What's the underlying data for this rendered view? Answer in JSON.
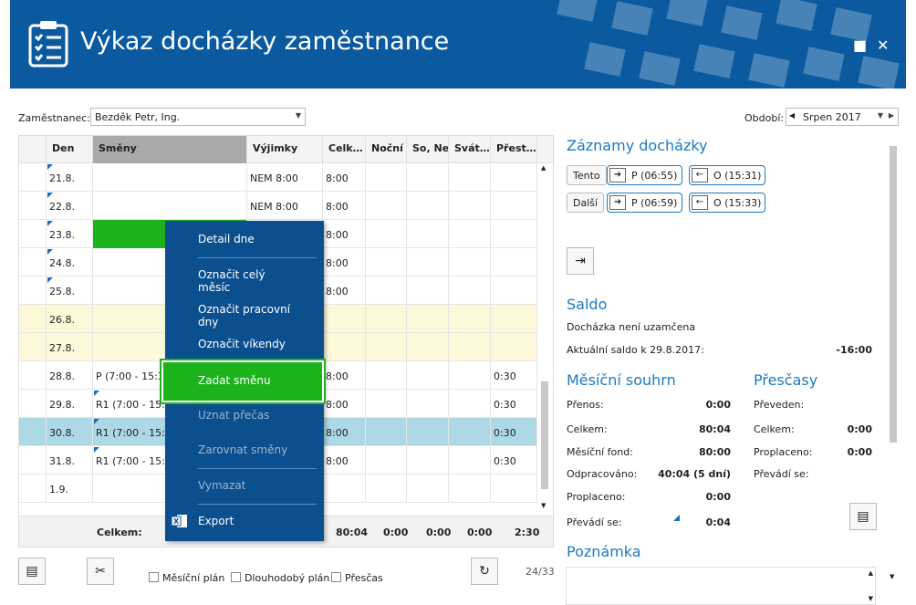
{
  "window": {
    "title": "Výkaz docházky zaměstnance",
    "maximize_icon": "■",
    "close_icon": "✕"
  },
  "filters": {
    "employee_label": "Zaměstnanec:",
    "employee_value": "Bezděk Petr, Ing.",
    "period_label": "Období:",
    "period_value": "Srpen 2017"
  },
  "grid": {
    "columns": [
      "Den",
      "Směny",
      "Výjimky",
      "Celk…",
      "Noční",
      "So, Ne",
      "Svát…",
      "Přest…"
    ],
    "rows": [
      {
        "day": "21.8.",
        "shift": "",
        "exception": "NEM 8:00",
        "total": "8:00",
        "night": "",
        "weekend": "",
        "holiday": "",
        "break": ""
      },
      {
        "day": "22.8.",
        "shift": "",
        "exception": "NEM 8:00",
        "total": "8:00",
        "night": "",
        "weekend": "",
        "holiday": "",
        "break": ""
      },
      {
        "day": "23.8.",
        "shift": "",
        "exception": "",
        "total": "8:00",
        "night": "",
        "weekend": "",
        "holiday": "",
        "break": ""
      },
      {
        "day": "24.8.",
        "shift": "",
        "exception": "",
        "total": "8:00",
        "night": "",
        "weekend": "",
        "holiday": "",
        "break": ""
      },
      {
        "day": "25.8.",
        "shift": "",
        "exception": "",
        "total": "8:00",
        "night": "",
        "weekend": "",
        "holiday": "",
        "break": ""
      },
      {
        "day": "26.8.",
        "shift": "",
        "exception": "",
        "total": "",
        "night": "",
        "weekend": "",
        "holiday": "",
        "break": ""
      },
      {
        "day": "27.8.",
        "shift": "",
        "exception": "",
        "total": "",
        "night": "",
        "weekend": "",
        "holiday": "",
        "break": ""
      },
      {
        "day": "28.8.",
        "shift": "P (7:00 - 15:30",
        "exception": "",
        "total": "8:00",
        "night": "",
        "weekend": "",
        "holiday": "",
        "break": "0:30"
      },
      {
        "day": "29.8.",
        "shift": "R1 (7:00 - 15:30",
        "exception": "",
        "total": "8:00",
        "night": "",
        "weekend": "",
        "holiday": "",
        "break": "0:30"
      },
      {
        "day": "30.8.",
        "shift": "R1 (7:00 - 15:30",
        "exception": "",
        "total": "8:00",
        "night": "",
        "weekend": "",
        "holiday": "",
        "break": "0:30"
      },
      {
        "day": "31.8.",
        "shift": "R1 (7:00 - 15:30",
        "exception": "",
        "total": "8:00",
        "night": "",
        "weekend": "",
        "holiday": "",
        "break": "0:30"
      },
      {
        "day": "1.9.",
        "shift": "",
        "exception": "",
        "total": "",
        "night": "",
        "weekend": "",
        "holiday": "",
        "break": ""
      }
    ],
    "footer": {
      "label": "Celkem:",
      "total": "80:04",
      "night": "0:00",
      "weekend": "0:00",
      "holiday": "0:00",
      "break": "2:30"
    }
  },
  "context_menu": {
    "items": [
      "Detail dne",
      "Označit celý měsíc",
      "Označit pracovní dny",
      "Označit víkendy",
      "Zadat směnu",
      "Uznat přečas",
      "Zarovnat směny",
      "Vymazat",
      "Export"
    ]
  },
  "bottom": {
    "monthly_plan": "Měsíční plán",
    "long_plan": "Dlouhodobý plán",
    "overtime": "Přesčas",
    "counter": "24/33"
  },
  "records": {
    "title": "Záznamy docházky",
    "this_btn": "Tento",
    "next_btn": "Další",
    "row1_in": "P (06:55)",
    "row1_out": "O (15:31)",
    "row2_in": "P (06:59)",
    "row2_out": "O (15:33)"
  },
  "saldo": {
    "title": "Saldo",
    "status": "Docházka není uzamčena",
    "current_label": "Aktuální saldo k 29.8.2017:",
    "current_value": "-16:00"
  },
  "monthly": {
    "title": "Měsíční souhrn",
    "transfer_label": "Přenos:",
    "transfer_value": "0:00",
    "total_label": "Celkem:",
    "total_value": "80:04",
    "fund_label": "Měsíční fond:",
    "fund_value": "80:00",
    "worked_label": "Odpracováno:",
    "worked_value": "40:04 (5 dní)",
    "paid_label": "Proplaceno:",
    "paid_value": "0:00",
    "carry_label": "Převádí se:",
    "carry_value": "0:04"
  },
  "overtime": {
    "title": "Přesčasy",
    "transferred_label": "Převeden:",
    "transferred_value": "",
    "total_label": "Celkem:",
    "total_value": "0:00",
    "paid_label": "Proplaceno:",
    "paid_value": "0:00",
    "carry_label": "Převádí se:",
    "carry_value": ""
  },
  "note": {
    "title": "Poznámka"
  },
  "colors": {
    "accent": "#1a7bc4",
    "title_bar": "#0b5aa0",
    "menu": "#0b4f8f",
    "highlight_green": "#1db31d",
    "weekend_row": "#fdf8d8",
    "selected_row": "#add8e6"
  }
}
